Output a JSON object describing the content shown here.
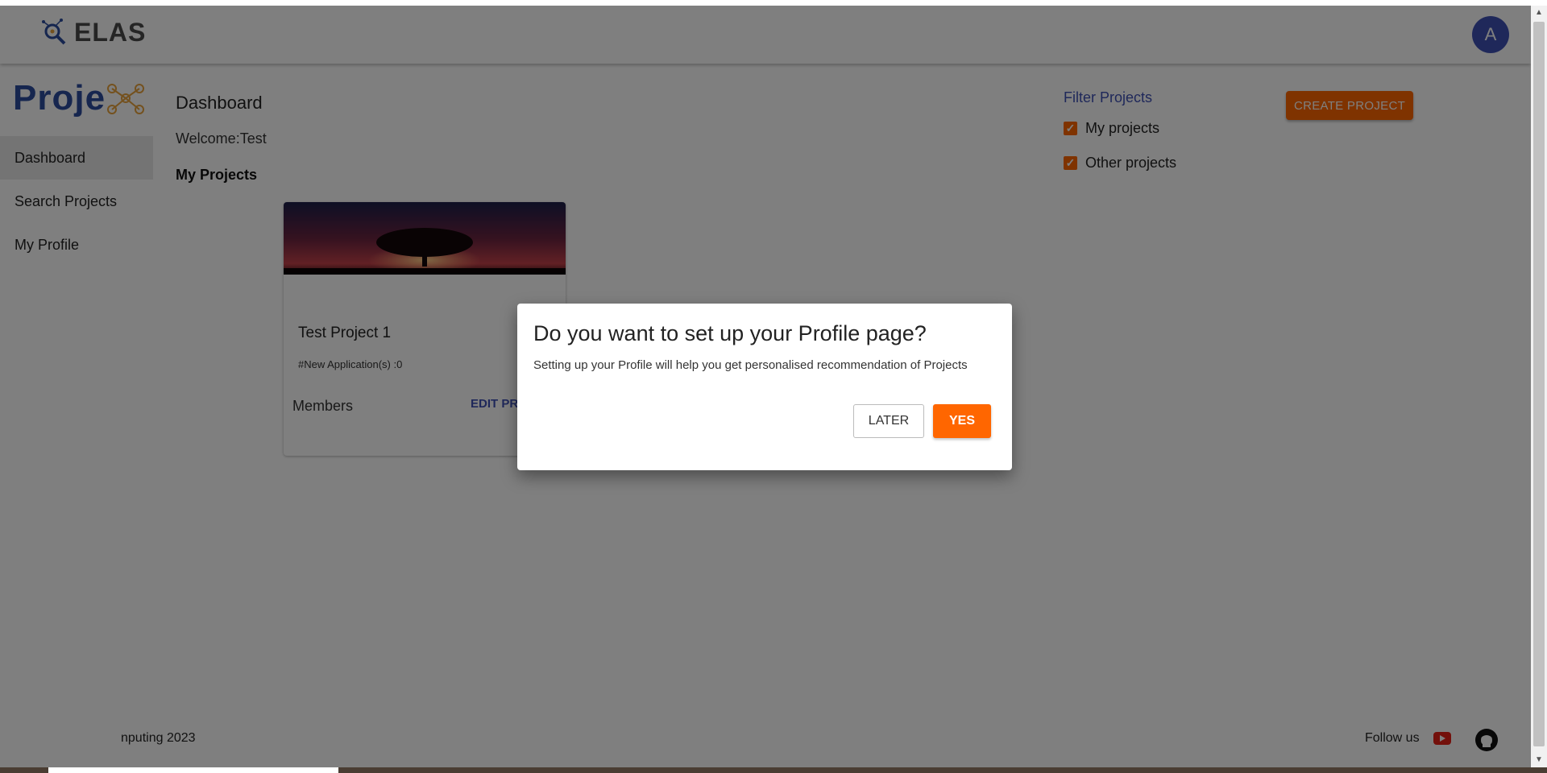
{
  "app": {
    "brand": "ELAS",
    "avatar_initial": "A",
    "project_logo": "Proje"
  },
  "sidebar": {
    "items": [
      {
        "label": "Dashboard",
        "active": true
      },
      {
        "label": "Search Projects",
        "active": false
      },
      {
        "label": "My Profile",
        "active": false
      }
    ]
  },
  "main": {
    "title": "Dashboard",
    "welcome": "Welcome:Test",
    "section_title": "My Projects",
    "create_button": "CREATE PROJECT",
    "filter": {
      "title": "Filter Projects",
      "options": [
        {
          "label": "My projects",
          "checked": true
        },
        {
          "label": "Other projects",
          "checked": true
        }
      ]
    },
    "card": {
      "title": "Test Project 1",
      "applications": "#New Application(s) :0",
      "members_label": "Members",
      "edit_label": "EDIT PRO"
    }
  },
  "footer": {
    "copyright": "nputing 2023",
    "follow": "Follow us"
  },
  "dialog": {
    "title": "Do you want to set up your Profile page?",
    "text": "Setting up your Profile will help you get personalised recommendation of Projects",
    "later_button": "LATER",
    "yes_button": "YES"
  },
  "colors": {
    "accent": "#ff6600",
    "primary": "#3f51b5",
    "overlay": "rgba(0,0,0,0.5)"
  }
}
